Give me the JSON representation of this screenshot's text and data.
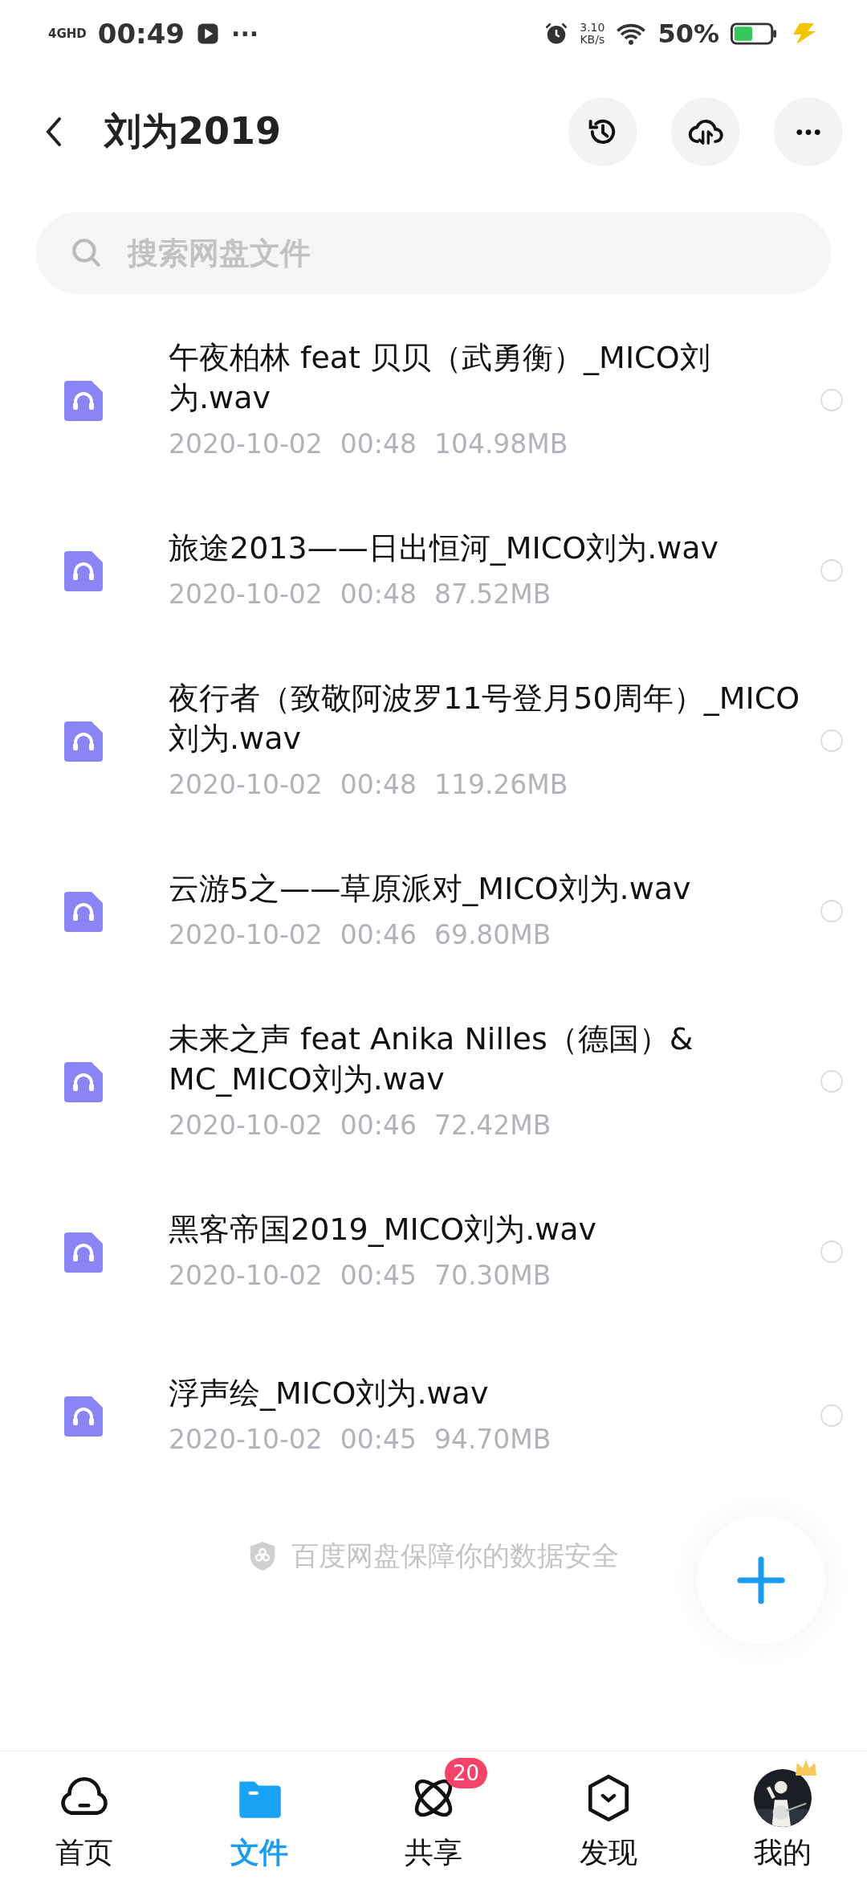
{
  "status_bar": {
    "network": "4GHD",
    "time": "00:49",
    "more": "···",
    "speed": "3.10",
    "speed_unit": "KB/s",
    "battery": "50%"
  },
  "header": {
    "title": "刘为2019"
  },
  "search": {
    "placeholder": "搜索网盘文件"
  },
  "files": [
    {
      "name": "午夜柏林 feat 贝贝（武勇衡）_MICO刘为.wav",
      "date": "2020-10-02",
      "time": "00:48",
      "size": "104.98MB",
      "selected": false
    },
    {
      "name": "旅途2013——日出恒河_MICO刘为.wav",
      "date": "2020-10-02",
      "time": "00:48",
      "size": "87.52MB",
      "selected": false
    },
    {
      "name": "夜行者（致敬阿波罗11号登月50周年）_MICO刘为.wav",
      "date": "2020-10-02",
      "time": "00:48",
      "size": "119.26MB",
      "selected": false
    },
    {
      "name": "云游5之——草原派对_MICO刘为.wav",
      "date": "2020-10-02",
      "time": "00:46",
      "size": "69.80MB",
      "selected": false
    },
    {
      "name": "未来之声 feat Anika Nilles（德国）& MC_MICO刘为.wav",
      "date": "2020-10-02",
      "time": "00:46",
      "size": "72.42MB",
      "selected": false
    },
    {
      "name": "黑客帝国2019_MICO刘为.wav",
      "date": "2020-10-02",
      "time": "00:45",
      "size": "70.30MB",
      "selected": false
    },
    {
      "name": "浮声绘_MICO刘为.wav",
      "date": "2020-10-02",
      "time": "00:45",
      "size": "94.70MB",
      "selected": false
    }
  ],
  "footer_note": "百度网盘保障你的数据安全",
  "tabs": [
    {
      "kind": "home",
      "label": "首页",
      "selected": false
    },
    {
      "kind": "files",
      "label": "文件",
      "selected": true
    },
    {
      "kind": "share",
      "label": "共享",
      "selected": false,
      "badge": "20"
    },
    {
      "kind": "discover",
      "label": "发现",
      "selected": false
    },
    {
      "kind": "me",
      "label": "我的",
      "selected": false
    }
  ]
}
